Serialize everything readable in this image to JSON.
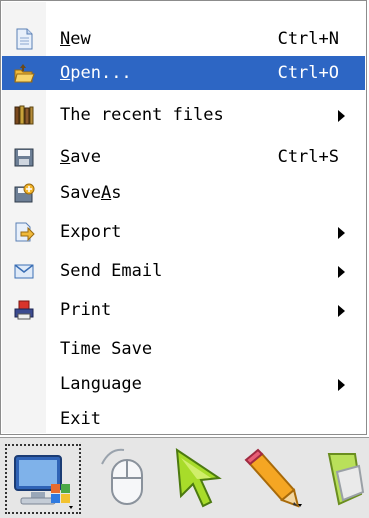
{
  "menu": {
    "items": [
      {
        "label": "New",
        "mnemonic": "N",
        "shortcut": "Ctrl+N",
        "icon": "new-file-icon"
      },
      {
        "label": "Open...",
        "mnemonic": "O",
        "shortcut": "Ctrl+O",
        "icon": "open-folder-icon",
        "highlighted": true
      },
      {
        "label": "The recent files",
        "shortcut": "",
        "icon": "recent-files-icon",
        "submenu": true
      },
      {
        "label": "Save",
        "mnemonic": "S",
        "shortcut": "Ctrl+S",
        "icon": "save-icon"
      },
      {
        "label": "SaveAs",
        "mnemonic": "A",
        "shortcut": "",
        "icon": "save-as-icon"
      },
      {
        "label": "Export",
        "shortcut": "",
        "icon": "export-icon",
        "submenu": true
      },
      {
        "label": "Send Email",
        "shortcut": "",
        "icon": "email-icon",
        "submenu": true
      },
      {
        "label": "Print",
        "shortcut": "",
        "icon": "printer-icon",
        "submenu": true
      },
      {
        "label": "Time Save",
        "shortcut": "",
        "icon": ""
      },
      {
        "label": "Language",
        "shortcut": "",
        "icon": "",
        "submenu": true
      },
      {
        "label": "Exit",
        "shortcut": "",
        "icon": ""
      }
    ]
  },
  "toolbar": {
    "tools": [
      {
        "name": "computer-tool",
        "icon": "computer-icon",
        "selected": true
      },
      {
        "name": "mouse-tool",
        "icon": "mouse-icon"
      },
      {
        "name": "pointer-tool",
        "icon": "arrow-cursor-icon"
      },
      {
        "name": "pencil-tool",
        "icon": "pencil-icon"
      },
      {
        "name": "eraser-tool",
        "icon": "eraser-icon"
      }
    ]
  },
  "colors": {
    "highlight": "#2d66c4",
    "gutter": "#f4f4f4",
    "toolbar_bg": "#e6e6e6"
  }
}
